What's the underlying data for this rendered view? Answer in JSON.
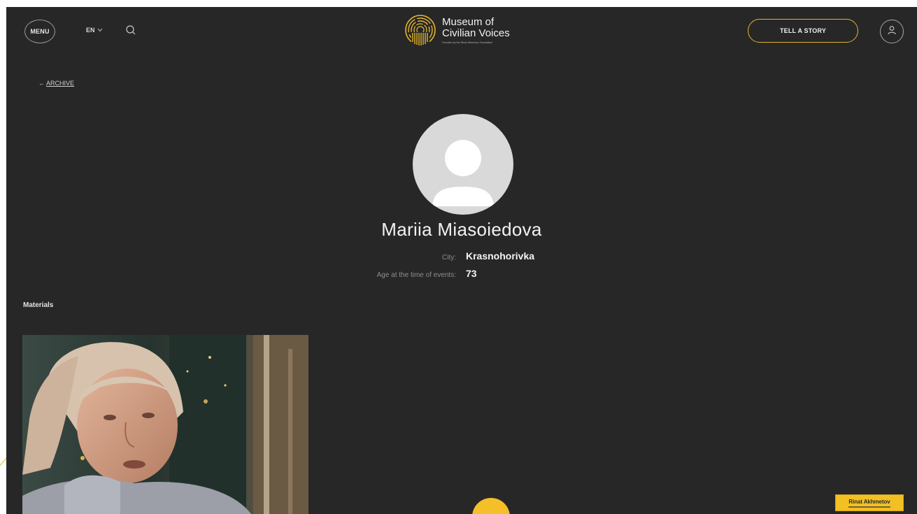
{
  "header": {
    "menu_label": "MENU",
    "language": "EN",
    "logo_line1": "Museum of",
    "logo_line2": "Civilian Voices",
    "logo_subtitle": "Founded by the Rinat Akhmetov Foundation",
    "cta_label": "TELL A STORY",
    "accent_color": "#e2b52a",
    "icons": [
      "search-icon",
      "chevron-down-icon",
      "user-icon",
      "fingerprint-logo-icon"
    ]
  },
  "navigation": {
    "back_label": "ARCHIVE",
    "back_arrow": "←"
  },
  "profile": {
    "name": "Mariia Miasoiedova",
    "city_label": "City:",
    "city_value": "Krasnohorivka",
    "age_label": "Age at the time of events:",
    "age_value": "73"
  },
  "materials": {
    "title": "Materials",
    "items": [
      {
        "type": "video-thumbnail"
      }
    ]
  },
  "partner": {
    "label": "Rinat Akhmetov",
    "color": "#f2c024"
  },
  "colors": {
    "background": "#272727",
    "text": "#f2f2f2",
    "muted": "#8e8e8e"
  }
}
